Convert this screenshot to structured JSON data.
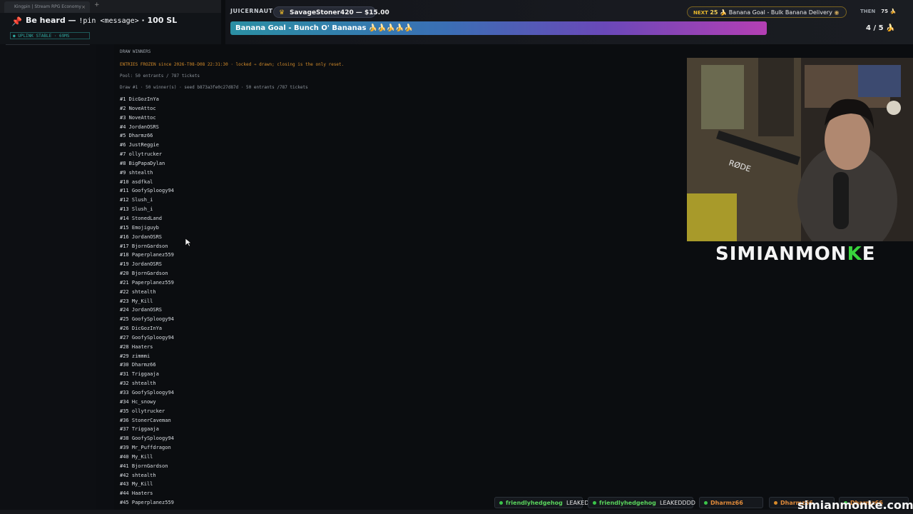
{
  "browser_tab": {
    "title": "Kingpin | Stream RPG Economy",
    "close": "×",
    "new": "+"
  },
  "pin": {
    "text": "Be heard — ",
    "command": "!pin <message>",
    "cost": " · 100 SL",
    "uplink": "● UPLINK STABLE · 69MS"
  },
  "header": {
    "top_donor_label": "JUICERNAUT",
    "donation_user": "SavageStoner420 — $15.00",
    "goal_text": "Banana Goal - Bunch O' Bananas 🍌🍌🍌🍌🍌",
    "next_label": "NEXT",
    "next_count": "25 🍌",
    "next_goal": "Banana Goal - Bulk Banana Delivery",
    "then_label": "THEN",
    "then_value": "75 🍌",
    "progress": "4 / 5 🍌"
  },
  "terminal": {
    "section_title": "DRAW WINNERS",
    "frozen_notice": "ENTRIES FROZEN since 2026-T08-D08 22:31:30 · locked ⇒ drawn; closing is the only reset.",
    "pool": "Pool: 50 entrants / 787 tickets",
    "draw_line": "Draw #1 · 50 winner(s) · seed b873a3fe0c27d87d · 50 entrants /787 tickets",
    "winners": [
      {
        "rank": "#1",
        "name": "DicGozInYa"
      },
      {
        "rank": "#2",
        "name": "NoveAttoc"
      },
      {
        "rank": "#3",
        "name": "NoveAttoc"
      },
      {
        "rank": "#4",
        "name": "JordanOSRS"
      },
      {
        "rank": "#5",
        "name": "Dharmz66"
      },
      {
        "rank": "#6",
        "name": "JustReggie"
      },
      {
        "rank": "#7",
        "name": "ollytrucker"
      },
      {
        "rank": "#8",
        "name": "BigPapaDylan"
      },
      {
        "rank": "#9",
        "name": "shtealth"
      },
      {
        "rank": "#10",
        "name": "asdfkal"
      },
      {
        "rank": "#11",
        "name": "GoofySploogy94"
      },
      {
        "rank": "#12",
        "name": "Slush_i"
      },
      {
        "rank": "#13",
        "name": "Slush_i"
      },
      {
        "rank": "#14",
        "name": "StonedLand"
      },
      {
        "rank": "#15",
        "name": "Emojiguyb"
      },
      {
        "rank": "#16",
        "name": "JordanOSRS"
      },
      {
        "rank": "#17",
        "name": "BjornGardson"
      },
      {
        "rank": "#18",
        "name": "Paperplanez559"
      },
      {
        "rank": "#19",
        "name": "JordanOSRS"
      },
      {
        "rank": "#20",
        "name": "BjornGardson"
      },
      {
        "rank": "#21",
        "name": "Paperplanez559"
      },
      {
        "rank": "#22",
        "name": "shtealth"
      },
      {
        "rank": "#23",
        "name": "My_Kill"
      },
      {
        "rank": "#24",
        "name": "JordanOSRS"
      },
      {
        "rank": "#25",
        "name": "GoofySploogy94"
      },
      {
        "rank": "#26",
        "name": "DicGozInYa"
      },
      {
        "rank": "#27",
        "name": "GoofySploogy94"
      },
      {
        "rank": "#28",
        "name": "Haaters"
      },
      {
        "rank": "#29",
        "name": "zimmmi"
      },
      {
        "rank": "#30",
        "name": "Dharmz66"
      },
      {
        "rank": "#31",
        "name": "Triggaaja"
      },
      {
        "rank": "#32",
        "name": "shtealth"
      },
      {
        "rank": "#33",
        "name": "GoofySploogy94"
      },
      {
        "rank": "#34",
        "name": "Hc_snowy"
      },
      {
        "rank": "#35",
        "name": "ollytrucker"
      },
      {
        "rank": "#36",
        "name": "StonerCaveman"
      },
      {
        "rank": "#37",
        "name": "Triggaaja"
      },
      {
        "rank": "#38",
        "name": "GoofySploogy94"
      },
      {
        "rank": "#39",
        "name": "Mr_Puffdragon"
      },
      {
        "rank": "#40",
        "name": "My_Kill"
      },
      {
        "rank": "#41",
        "name": "BjornGardson"
      },
      {
        "rank": "#42",
        "name": "shtealth"
      },
      {
        "rank": "#43",
        "name": "My_Kill"
      },
      {
        "rank": "#44",
        "name": "Haaters"
      },
      {
        "rank": "#45",
        "name": "Paperplanez559"
      }
    ]
  },
  "branding": {
    "name_main": "SIMIANMON",
    "name_accent": "K",
    "name_end": "E",
    "watermark": "simianmonke.com"
  },
  "chat": [
    {
      "user": "friendlyhedgehog",
      "message": "LEAKED"
    },
    {
      "user": "friendlyhedgehog",
      "message": "LEAKEDDDD"
    },
    {
      "user": "Dharmz66",
      "message": ""
    },
    {
      "user": "Dharmz66",
      "message": ""
    },
    {
      "user": "Dharmz66",
      "message": ""
    }
  ],
  "colors": {
    "accent_orange": "#d38b2a",
    "goal_start": "#2b8fa3",
    "goal_end": "#b43fb4",
    "brand_green": "#38d43c"
  }
}
